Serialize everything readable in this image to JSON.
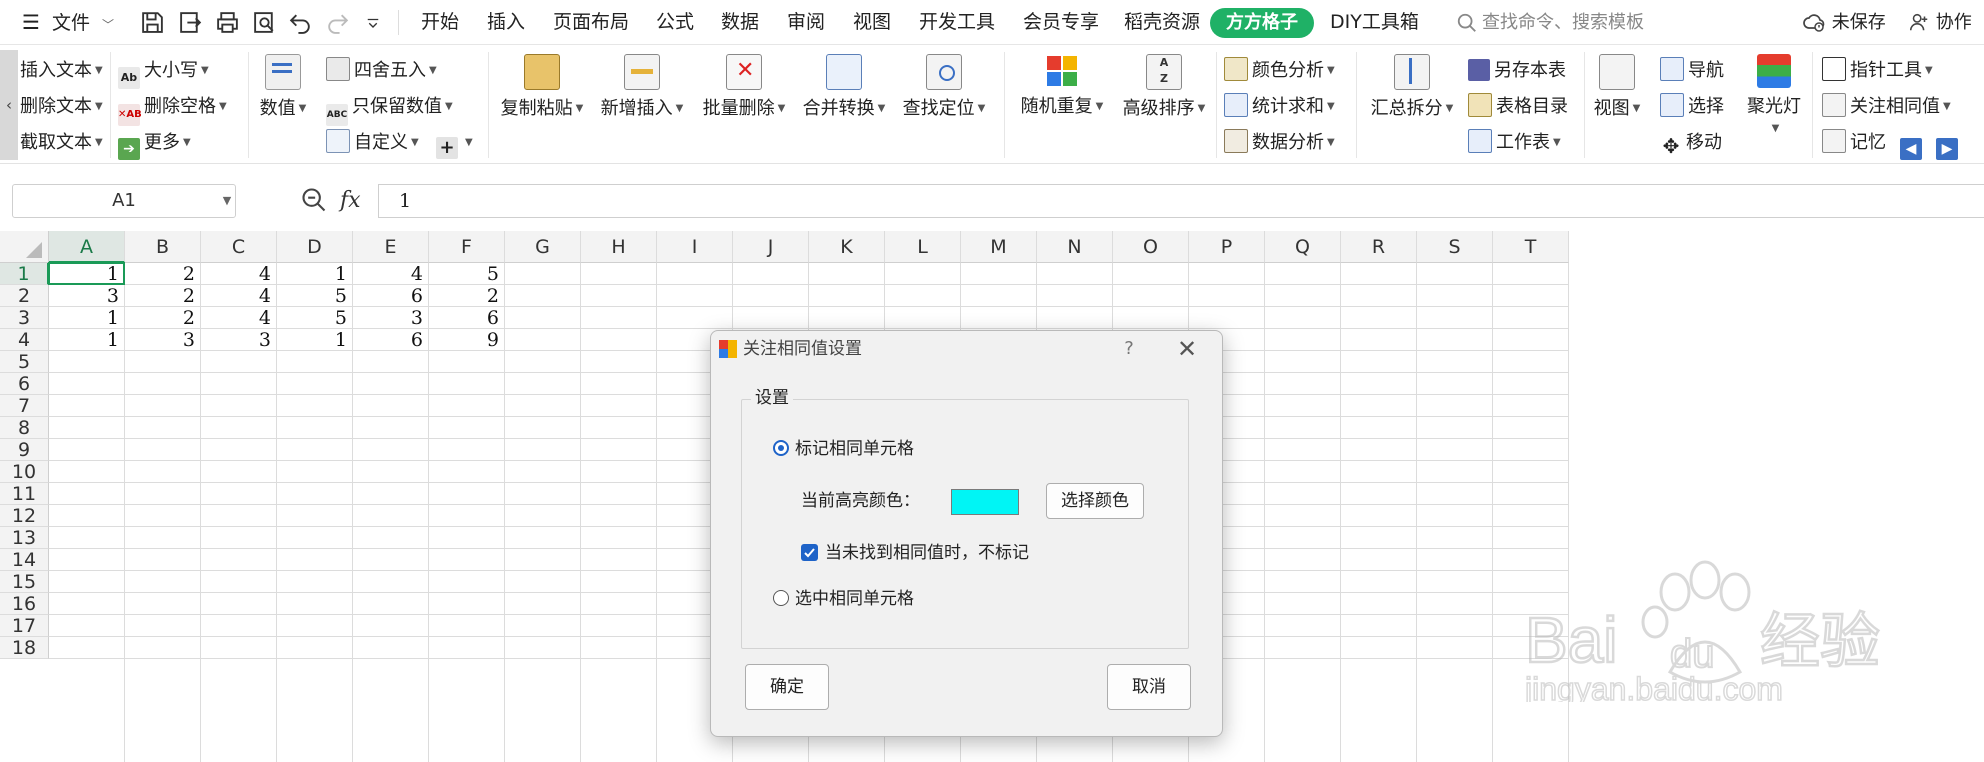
{
  "topbar": {
    "file_label": "文件",
    "tabs": [
      "开始",
      "插入",
      "页面布局",
      "公式",
      "数据",
      "审阅",
      "视图",
      "开发工具",
      "会员专享",
      "稻壳资源",
      "方方格子",
      "DIY工具箱"
    ],
    "active_tab": "方方格子",
    "search_placeholder": "查找命令、搜索模板",
    "unsaved_label": "未保存",
    "collab_label": "协作"
  },
  "ribbon": {
    "g1": [
      "插入文本",
      "删除文本",
      "截取文本"
    ],
    "g2": [
      "大小写",
      "删除空格",
      "更多"
    ],
    "g3_big": "数值",
    "g4": [
      "四舍五入",
      "只保留数值",
      "自定义"
    ],
    "g5": [
      "复制粘贴",
      "新增插入",
      "批量删除",
      "合并转换",
      "查找定位"
    ],
    "g6": [
      "随机重复",
      "高级排序"
    ],
    "g7": [
      "颜色分析",
      "统计求和",
      "数据分析"
    ],
    "g8_big": "汇总拆分",
    "g9": [
      "另存本表",
      "表格目录",
      "工作表"
    ],
    "g10_big": "视图",
    "g11": [
      "导航",
      "选择",
      "移动"
    ],
    "g12_big": "聚光灯",
    "g13": [
      "指针工具",
      "关注相同值",
      "记忆"
    ]
  },
  "formula_bar": {
    "cell_ref": "A1",
    "fx_label": "fx",
    "value": "1"
  },
  "sheet": {
    "columns": [
      "A",
      "B",
      "C",
      "D",
      "E",
      "F",
      "G",
      "H",
      "I",
      "J",
      "K",
      "L",
      "M",
      "N",
      "O",
      "P",
      "Q",
      "R",
      "S",
      "T"
    ],
    "rows": [
      "1",
      "2",
      "3",
      "4",
      "5",
      "6",
      "7",
      "8",
      "9",
      "10",
      "11",
      "12",
      "13",
      "14",
      "15",
      "16",
      "17",
      "18"
    ],
    "data": [
      [
        "1",
        "2",
        "4",
        "1",
        "4",
        "5"
      ],
      [
        "3",
        "2",
        "4",
        "5",
        "6",
        "2"
      ],
      [
        "1",
        "2",
        "4",
        "5",
        "3",
        "6"
      ],
      [
        "1",
        "3",
        "3",
        "1",
        "6",
        "9"
      ]
    ],
    "selected_cell": "A1"
  },
  "dialog": {
    "title": "关注相同值设置",
    "help": "?",
    "close": "✕",
    "group_label": "设置",
    "option_mark": "标记相同单元格",
    "highlight_label": "当前高亮颜色：",
    "highlight_color": "#00f5f5",
    "choose_color_button": "选择颜色",
    "no_mark_checkbox": "当未找到相同值时，不标记",
    "option_select": "选中相同单元格",
    "ok_button": "确定",
    "cancel_button": "取消"
  },
  "watermark": {
    "brand": "Bai",
    "brand2": "du",
    "brand_cn": "经验",
    "url": "jingyan.baidu.com"
  },
  "colors": {
    "accent_green": "#1fb166",
    "selection_green": "#1a9a57",
    "radio_blue": "#1e63c8"
  }
}
